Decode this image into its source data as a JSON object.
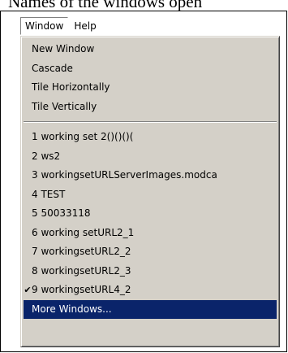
{
  "document": {
    "top_text": "Names of the windows open"
  },
  "menubar": {
    "items": [
      {
        "label": "Window",
        "active": true
      },
      {
        "label": "Help",
        "active": false
      }
    ]
  },
  "window_menu": {
    "group1": [
      {
        "label": "New Window"
      },
      {
        "label": "Cascade"
      },
      {
        "label": "Tile Horizontally"
      },
      {
        "label": "Tile Vertically"
      }
    ],
    "group2": [
      {
        "label": "1 working set 2()()()(",
        "checked": false
      },
      {
        "label": "2 ws2",
        "checked": false
      },
      {
        "label": "3 workingsetURLServerImages.modca",
        "checked": false
      },
      {
        "label": "4 TEST",
        "checked": false
      },
      {
        "label": "5 50033118",
        "checked": false
      },
      {
        "label": "6 working setURL2_1",
        "checked": false
      },
      {
        "label": "7 workingsetURL2_2",
        "checked": false
      },
      {
        "label": "8 workingsetURL2_3",
        "checked": false
      },
      {
        "label": "9 workingsetURL4_2",
        "checked": true
      }
    ],
    "check_glyph": "✔",
    "more_windows": {
      "label": "More Windows...",
      "highlighted": true
    },
    "colors": {
      "menu_bg": "#d4d0c8",
      "highlight_bg": "#0a246a",
      "highlight_text": "#ffffff"
    }
  }
}
